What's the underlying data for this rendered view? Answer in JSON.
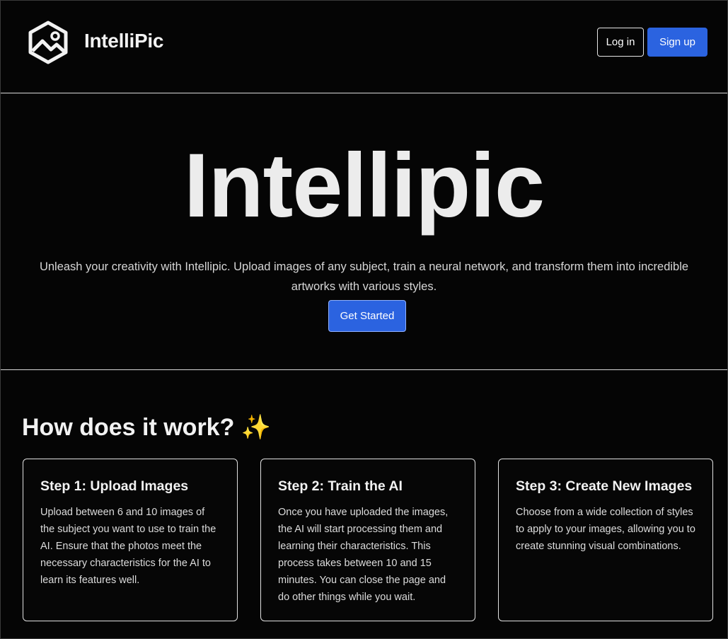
{
  "header": {
    "brand_name": "IntelliPic",
    "login_label": "Log in",
    "signup_label": "Sign up"
  },
  "hero": {
    "wordmark": "Intellipic",
    "description": "Unleash your creativity with Intellipic. Upload images of any subject, train a neural network, and transform them into incredible artworks with various styles.",
    "cta_label": "Get Started"
  },
  "how": {
    "title": "How does it work?",
    "title_emoji": "✨",
    "steps": [
      {
        "title": "Step 1: Upload Images",
        "text": "Upload between 6 and 10 images of the subject you want to use to train the AI. Ensure that the photos meet the necessary characteristics for the AI to learn its features well."
      },
      {
        "title": "Step 2: Train the AI",
        "text": "Once you have uploaded the images, the AI will start processing them and learning their characteristics. This process takes between 10 and 15 minutes. You can close the page and do other things while you wait."
      },
      {
        "title": "Step 3: Create New Images",
        "text": "Choose from a wide collection of styles to apply to your images, allowing you to create stunning visual combinations."
      }
    ]
  },
  "theme": {
    "background": "#050505",
    "accent": "#2b63e0",
    "text": "#ffffff",
    "border": "#d9d9d9"
  },
  "icons": {
    "logo": "image-hexagon-logo-icon",
    "sparkle": "sparkles-icon"
  }
}
